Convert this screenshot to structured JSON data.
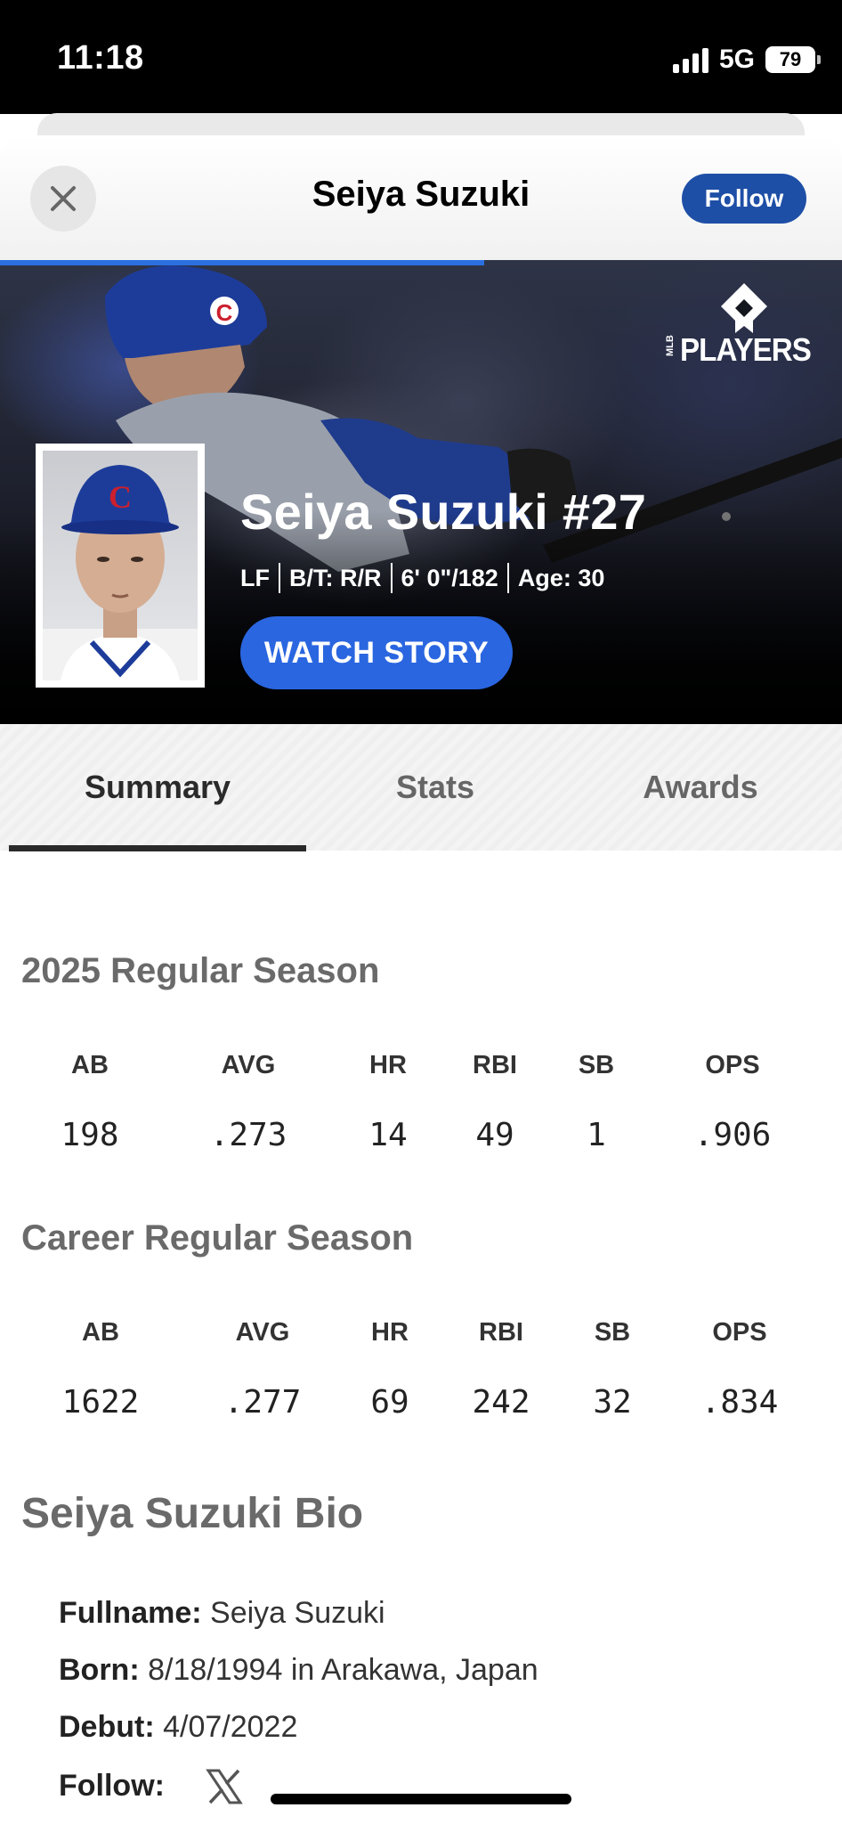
{
  "status_bar": {
    "time": "11:18",
    "network": "5G",
    "battery": "79"
  },
  "header": {
    "title": "Seiya Suzuki",
    "follow_label": "Follow",
    "close_icon": "close-icon"
  },
  "hero": {
    "story_progress": 0.575,
    "logo_text": "PLAYERS",
    "logo_small": "MLB",
    "name": "Seiya Suzuki #27",
    "position": "LF",
    "bats_throws": "B/T: R/R",
    "height_weight": "6' 0\"/182",
    "age": "Age: 30",
    "watch_label": "WATCH STORY",
    "cap_letter": "C",
    "colors": {
      "accent": "#2a66e0",
      "follow": "#1e4fa6",
      "cubs_blue": "#1d3c9a",
      "cubs_red": "#cc1f2d"
    }
  },
  "tabs": [
    {
      "label": "Summary",
      "active": true
    },
    {
      "label": "Stats",
      "active": false
    },
    {
      "label": "Awards",
      "active": false
    }
  ],
  "season": {
    "title": "2025 Regular Season",
    "headers": [
      "AB",
      "AVG",
      "HR",
      "RBI",
      "SB",
      "OPS"
    ],
    "values": [
      "198",
      ".273",
      "14",
      "49",
      "1",
      ".906"
    ]
  },
  "career": {
    "title": "Career Regular Season",
    "headers": [
      "AB",
      "AVG",
      "HR",
      "RBI",
      "SB",
      "OPS"
    ],
    "values": [
      "1622",
      ".277",
      "69",
      "242",
      "32",
      ".834"
    ]
  },
  "bio": {
    "title": "Seiya Suzuki Bio",
    "fullname_label": "Fullname:",
    "fullname": "Seiya Suzuki",
    "born_label": "Born:",
    "born": "8/18/1994 in Arakawa, Japan",
    "debut_label": "Debut:",
    "debut": "4/07/2022",
    "follow_label": "Follow:",
    "social_icon": "x-icon"
  }
}
